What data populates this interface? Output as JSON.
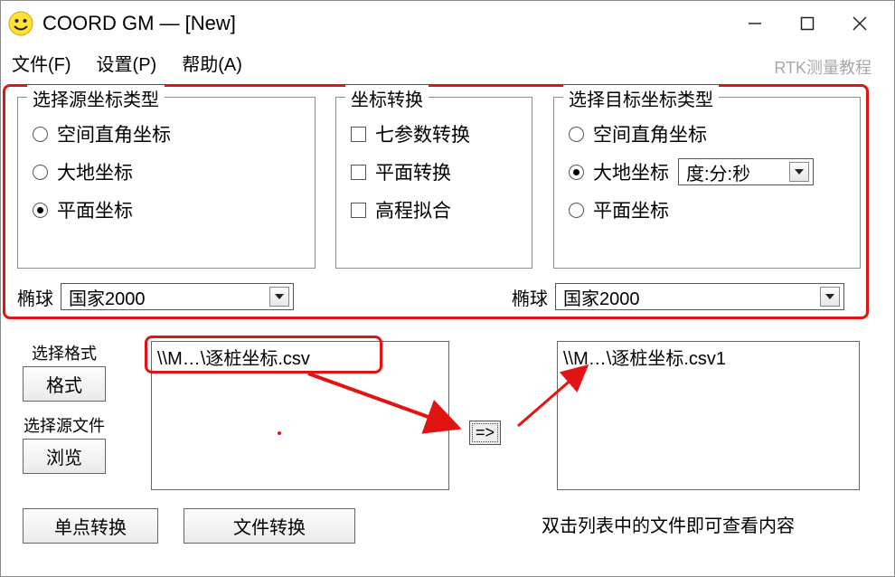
{
  "window": {
    "title": "COORD GM — [New]"
  },
  "menus": {
    "file": "文件(F)",
    "settings": "设置(P)",
    "help": "帮助(A)"
  },
  "source_group": {
    "title": "选择源坐标类型",
    "opt_cartesian": "空间直角坐标",
    "opt_geodetic": "大地坐标",
    "opt_plane": "平面坐标"
  },
  "conv_group": {
    "title": "坐标转换",
    "chk_seven": "七参数转换",
    "chk_plane": "平面转换",
    "chk_elev": "高程拟合"
  },
  "target_group": {
    "title": "选择目标坐标类型",
    "opt_cartesian": "空间直角坐标",
    "opt_geodetic": "大地坐标",
    "opt_plane": "平面坐标",
    "format_selected": "度:分:秒"
  },
  "ellipsoid": {
    "label": "椭球",
    "value_left": "国家2000",
    "value_right": "国家2000"
  },
  "side": {
    "format_label": "选择格式",
    "format_btn": "格式",
    "src_label": "选择源文件",
    "browse_btn": "浏览"
  },
  "lists": {
    "left_entry": "\\\\M…\\逐桩坐标.csv",
    "right_entry": "\\\\M…\\逐桩坐标.csv1"
  },
  "buttons": {
    "single": "单点转换",
    "file": "文件转换",
    "arrow": "=>"
  },
  "hint": "双击列表中的文件即可查看内容",
  "watermark": "RTK测量教程"
}
